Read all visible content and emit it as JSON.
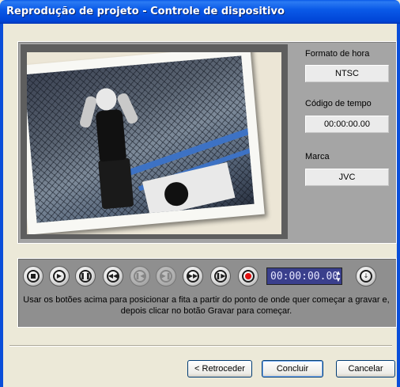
{
  "window": {
    "title": "Reprodução de projeto - Controle de dispositivo"
  },
  "settings": {
    "time_format_label": "Formato de hora",
    "time_format_value": "NTSC",
    "timecode_label": "Código de tempo",
    "timecode_value": "00:00:00.00",
    "brand_label": "Marca",
    "brand_value": "JVC"
  },
  "transport": {
    "buttons": [
      {
        "name": "stop",
        "icon": "stop-icon",
        "enabled": true
      },
      {
        "name": "play",
        "icon": "play-icon",
        "enabled": true
      },
      {
        "name": "pause",
        "icon": "pause-icon",
        "enabled": true
      },
      {
        "name": "rewind",
        "icon": "rewind-icon",
        "enabled": true
      },
      {
        "name": "step-back",
        "icon": "step-back-icon",
        "enabled": false
      },
      {
        "name": "step-forward",
        "icon": "step-forward-icon",
        "enabled": false
      },
      {
        "name": "fast-forward",
        "icon": "fast-forward-icon",
        "enabled": true
      },
      {
        "name": "next-frame",
        "icon": "next-frame-icon",
        "enabled": true
      },
      {
        "name": "record",
        "icon": "record-icon",
        "enabled": true
      }
    ],
    "timecode_display": "00:00:00.00",
    "goto_icon": "goto-icon",
    "instruction": "Usar os botões acima para posicionar a fita a partir do ponto de onde quer começar a gravar e, depois clicar no botão Gravar para começar."
  },
  "footer": {
    "back_label": "< Retroceder",
    "finish_label": "Concluir",
    "cancel_label": "Cancelar"
  },
  "colors": {
    "titlebar": "#0a5ae8",
    "panel": "#a5a5a5",
    "timecode_bg": "#3a3f8c",
    "record": "#e01010"
  }
}
